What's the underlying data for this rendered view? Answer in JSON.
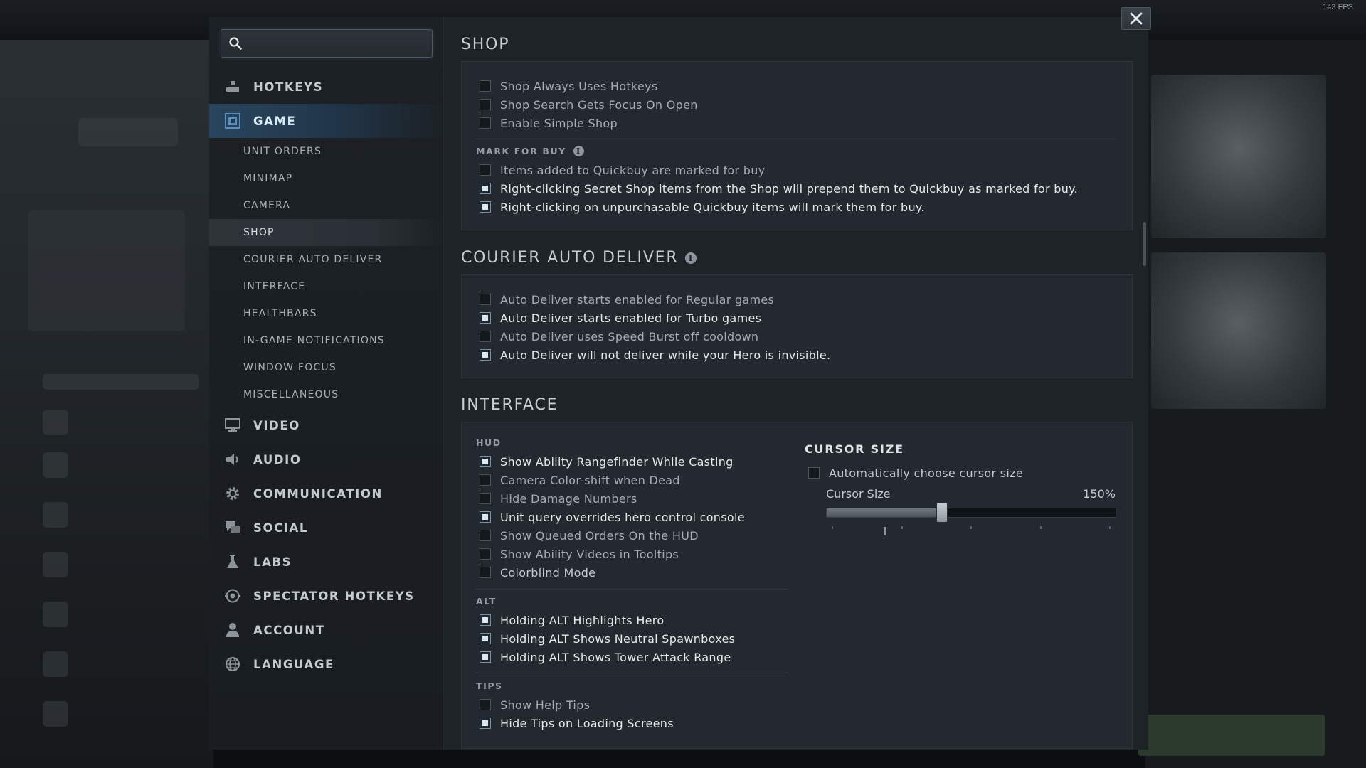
{
  "fps": "143 FPS",
  "search": {
    "placeholder": "",
    "value": ""
  },
  "nav": {
    "hotkeys": "HOTKEYS",
    "game": "GAME",
    "sub_items": [
      "UNIT ORDERS",
      "MINIMAP",
      "CAMERA",
      "SHOP",
      "COURIER AUTO DELIVER",
      "INTERFACE",
      "HEALTHBARS",
      "IN-GAME NOTIFICATIONS",
      "WINDOW FOCUS",
      "MISCELLANEOUS"
    ],
    "active_sub": "SHOP",
    "video": "VIDEO",
    "audio": "AUDIO",
    "communication": "COMMUNICATION",
    "social": "SOCIAL",
    "labs": "LABS",
    "spectator_hotkeys": "SPECTATOR HOTKEYS",
    "account": "ACCOUNT",
    "language": "LANGUAGE"
  },
  "shop": {
    "title": "SHOP",
    "options": [
      {
        "label": "Shop Always Uses Hotkeys",
        "checked": false
      },
      {
        "label": "Shop Search Gets Focus On Open",
        "checked": false
      },
      {
        "label": "Enable Simple Shop",
        "checked": false
      }
    ],
    "mark_for_buy": {
      "heading": "MARK FOR BUY",
      "options": [
        {
          "label": "Items added to Quickbuy are marked for buy",
          "checked": false
        },
        {
          "label": "Right-clicking Secret Shop items from the Shop will prepend them to Quickbuy as marked for buy.",
          "checked": true
        },
        {
          "label": "Right-clicking on unpurchasable Quickbuy items will mark them for buy.",
          "checked": true
        }
      ]
    }
  },
  "courier": {
    "title": "COURIER AUTO DELIVER",
    "options": [
      {
        "label": "Auto Deliver starts enabled for Regular games",
        "checked": false
      },
      {
        "label": "Auto Deliver starts enabled for Turbo games",
        "checked": true
      },
      {
        "label": "Auto Deliver uses Speed Burst off cooldown",
        "checked": false
      },
      {
        "label": "Auto Deliver will not deliver while your Hero is invisible.",
        "checked": true
      }
    ]
  },
  "interface": {
    "title": "INTERFACE",
    "hud": {
      "heading": "HUD",
      "options": [
        {
          "label": "Show Ability Rangefinder While Casting",
          "checked": true
        },
        {
          "label": "Camera Color-shift when Dead",
          "checked": false
        },
        {
          "label": "Hide Damage Numbers",
          "checked": false
        },
        {
          "label": "Unit query overrides hero control console",
          "checked": true
        },
        {
          "label": "Show Queued Orders On the HUD",
          "checked": false
        },
        {
          "label": "Show Ability Videos in Tooltips",
          "checked": false
        },
        {
          "label": "Colorblind Mode",
          "checked": false
        }
      ]
    },
    "alt": {
      "heading": "ALT",
      "options": [
        {
          "label": "Holding ALT Highlights Hero",
          "checked": true
        },
        {
          "label": "Holding ALT Shows Neutral Spawnboxes",
          "checked": true
        },
        {
          "label": "Holding ALT Shows Tower Attack Range",
          "checked": true
        }
      ]
    },
    "tips": {
      "heading": "TIPS",
      "options": [
        {
          "label": "Show Help Tips",
          "checked": false
        },
        {
          "label": "Hide Tips on Loading Screens",
          "checked": true
        }
      ]
    },
    "cursor": {
      "heading": "CURSOR SIZE",
      "auto_label": "Automatically choose cursor size",
      "auto_checked": false,
      "slider_label": "Cursor Size",
      "slider_value": "150%",
      "slider_fraction": 0.4,
      "tick_count": 5,
      "default_tick_fraction": 0.2
    }
  },
  "colors": {
    "accent": "#29465e",
    "panel": "#23292e",
    "content_bg": "#1e2328",
    "sidebar_bg": "#1c2125"
  },
  "icons": {
    "hotkeys": "hotkeys-icon",
    "game": "game-icon",
    "video": "monitor-icon",
    "audio": "speaker-icon",
    "communication": "gear-icon",
    "social": "chat-icon",
    "labs": "flask-icon",
    "spectator_hotkeys": "spectator-icon",
    "account": "user-icon",
    "language": "globe-icon",
    "close": "close-icon",
    "search": "search-icon",
    "info": "info-icon"
  }
}
